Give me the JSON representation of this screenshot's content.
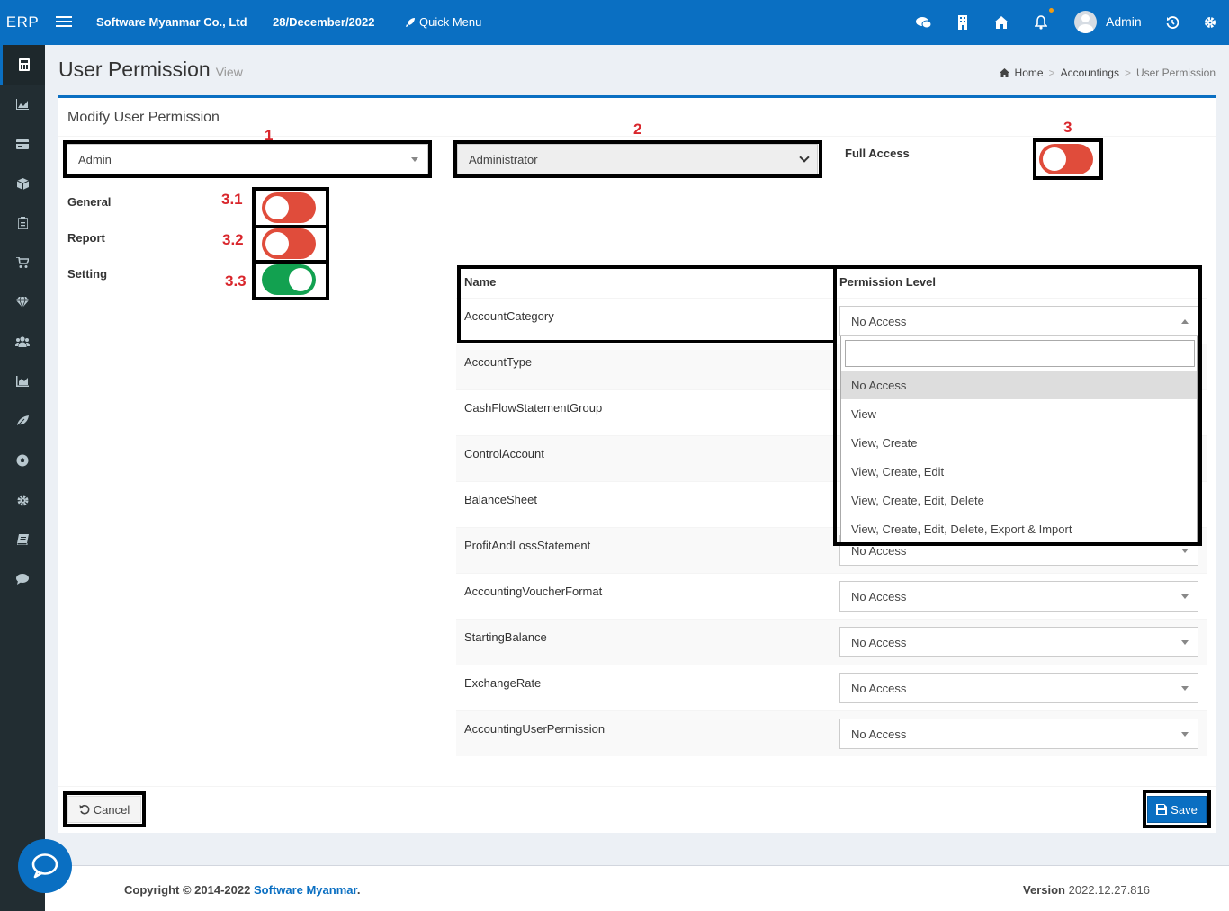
{
  "header": {
    "logo": "ERP",
    "company": "Software Myanmar Co., Ltd",
    "date": "28/December/2022",
    "quick_menu": "Quick Menu",
    "user": "Admin",
    "icons": [
      "chat-icon",
      "building-icon",
      "home-icon",
      "bell-icon",
      "history-icon",
      "gear-icon"
    ]
  },
  "sidebar": {
    "icons": [
      "calculator-icon",
      "chart-area-icon",
      "credit-card-icon",
      "cube-icon",
      "clipboard-icon",
      "cart-icon",
      "diamond-icon",
      "users-icon",
      "bar-chart-icon",
      "leaf-icon",
      "futbol-icon",
      "cog-icon",
      "book-icon",
      "comment-icon"
    ]
  },
  "page": {
    "title": "User Permission",
    "subtitle": "View",
    "breadcrumb": [
      "Home",
      "Accountings",
      "User Permission"
    ]
  },
  "form": {
    "box_title": "Modify User Permission",
    "user_select": "Admin",
    "role_select": "Administrator",
    "full_access_label": "Full Access",
    "full_access_on": false,
    "toggles": [
      {
        "label": "General",
        "marker": "3.1",
        "on": false
      },
      {
        "label": "Report",
        "marker": "3.2",
        "on": false
      },
      {
        "label": "Setting",
        "marker": "3.3",
        "on": true
      }
    ],
    "markers": {
      "user": "1",
      "role": "2",
      "full": "3"
    }
  },
  "table": {
    "headers": [
      "Name",
      "Permission Level"
    ],
    "rows": [
      {
        "name": "AccountCategory",
        "level": "No Access"
      },
      {
        "name": "AccountType",
        "level": ""
      },
      {
        "name": "CashFlowStatementGroup",
        "level": ""
      },
      {
        "name": "ControlAccount",
        "level": ""
      },
      {
        "name": "BalanceSheet",
        "level": ""
      },
      {
        "name": "ProfitAndLossStatement",
        "level": "No Access"
      },
      {
        "name": "AccountingVoucherFormat",
        "level": "No Access"
      },
      {
        "name": "StartingBalance",
        "level": "No Access"
      },
      {
        "name": "ExchangeRate",
        "level": "No Access"
      },
      {
        "name": "AccountingUserPermission",
        "level": "No Access"
      }
    ]
  },
  "dropdown": {
    "search_placeholder": "",
    "options": [
      "No Access",
      "View",
      "View, Create",
      "View, Create, Edit",
      "View, Create, Edit, Delete",
      "View, Create, Edit, Delete, Export & Import"
    ],
    "selected": 0
  },
  "buttons": {
    "cancel": "Cancel",
    "save": "Save"
  },
  "footer": {
    "copyright_prefix": "Copyright © 2014-2022 ",
    "copyright_link": "Software Myanmar",
    "copyright_suffix": ".",
    "version_label": "Version",
    "version_value": "2022.12.27.816"
  },
  "colors": {
    "brand": "#0a6fc2",
    "sidebar": "#222d32",
    "toggle_off": "#e04c3b",
    "toggle_on": "#12a150",
    "marker": "#d9262c"
  }
}
